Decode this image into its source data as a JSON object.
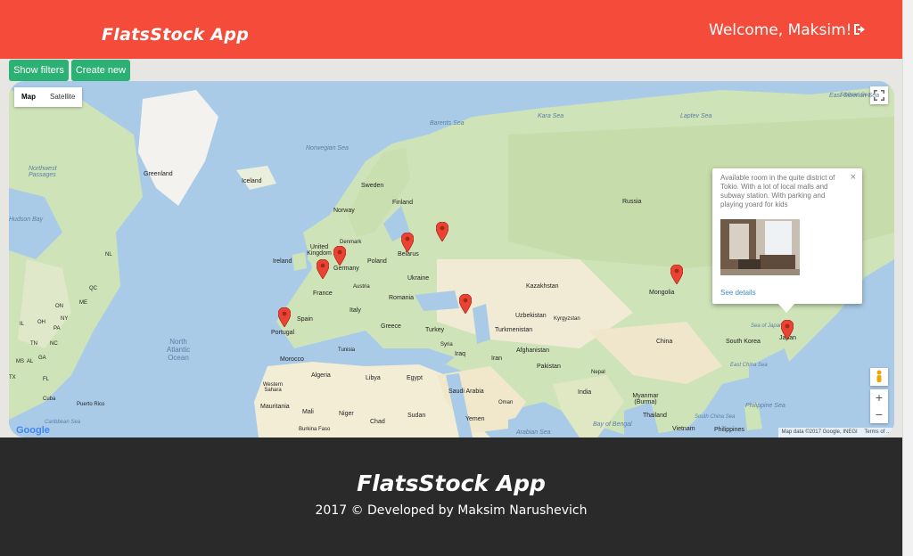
{
  "app": {
    "brand": "FlatsStock App",
    "welcome": "Welcome, Maksim!"
  },
  "toolbar": {
    "show_filters": "Show filters",
    "create_new": "Create new"
  },
  "map": {
    "type_options": [
      "Map",
      "Satellite"
    ],
    "selected_type": "Map",
    "attribution": "Map data ©2017 Google, INEGI",
    "terms": "Terms of ...",
    "google_logo": "Google",
    "zoom_in": "+",
    "zoom_out": "−",
    "labels": {
      "greenland": "Greenland",
      "iceland": "Iceland",
      "norwegian_sea": "Norwegian Sea",
      "barents_sea": "Barents Sea",
      "kara_sea": "Kara Sea",
      "laptev_sea": "Laptev Sea",
      "east_siberian_sea": "East Siberian Sea",
      "sweden": "Sweden",
      "finland": "Finland",
      "norway": "Norway",
      "russia": "Russia",
      "united_kingdom": "United Kingdom",
      "ireland": "Ireland",
      "denmark": "Denmark",
      "belarus": "Belarus",
      "poland": "Poland",
      "germany": "Germany",
      "ukraine": "Ukraine",
      "france": "France",
      "austria": "Austria",
      "romania": "Romania",
      "italy": "Italy",
      "spain": "Spain",
      "portugal": "Portugal",
      "greece": "Greece",
      "turkey": "Turkey",
      "kazakhstan": "Kazakhstan",
      "mongolia": "Mongolia",
      "uzbekistan": "Uzbekistan",
      "kyrgyzstan": "Kyrgyzstan",
      "turkmenistan": "Turkmenistan",
      "china": "China",
      "south_korea": "South Korea",
      "japan": "Japan",
      "sea_of_japan": "Sea of Japan",
      "syria": "Syria",
      "iraq": "Iraq",
      "iran": "Iran",
      "afghanistan": "Afghanistan",
      "pakistan": "Pakistan",
      "nepal": "Nepal",
      "india": "India",
      "myanmar": "Myanmar (Burma)",
      "thailand": "Thailand",
      "vietnam": "Vietnam",
      "philippines": "Philippines",
      "south_china_sea": "South China Sea",
      "philippine_sea": "Philippine Sea",
      "east_china_sea": "East China Sea",
      "bay_of_bengal": "Bay of Bengal",
      "arabian_sea": "Arabian Sea",
      "saudi_arabia": "Saudi Arabia",
      "oman": "Oman",
      "yemen": "Yemen",
      "egypt": "Egypt",
      "libya": "Libya",
      "tunisia": "Tunisia",
      "algeria": "Algeria",
      "morocco": "Morocco",
      "western_sahara": "Western Sahara",
      "mauritania": "Mauritania",
      "mali": "Mali",
      "niger": "Niger",
      "chad": "Chad",
      "sudan": "Sudan",
      "burkina_faso": "Burkina Faso",
      "north_atlantic_ocean": "North Atlantic Ocean",
      "hudson_bay": "Hudson Bay",
      "northwest_passages": "Northwest Passages",
      "nl": "NL",
      "qc": "QC",
      "on": "ON",
      "me": "ME",
      "ny": "NY",
      "pa": "PA",
      "il": "IL",
      "oh": "OH",
      "nc": "NC",
      "tn": "TN",
      "ga": "GA",
      "ms": "MS",
      "al": "AL",
      "tx": "TX",
      "fl": "FL",
      "cuba": "Cuba",
      "puerto_rico": "Puerto Rico",
      "caribbean_sea": "Caribbean Sea",
      "siberian_sea": "Siberian Sea"
    },
    "marker_count": 9
  },
  "infowindow": {
    "description": "Available room in the quite district of Tokio. With a lot of local malls and subway station. With parking and playing yoard for kids",
    "link": "See details",
    "close": "×"
  },
  "footer": {
    "brand": "FlatsStock App",
    "copyright": "2017 © Developed by Maksim Narushevich"
  },
  "colors": {
    "header": "#f44b3a",
    "button": "#2bb174",
    "footer": "#2b2a2a",
    "link": "#3a8fc7"
  }
}
